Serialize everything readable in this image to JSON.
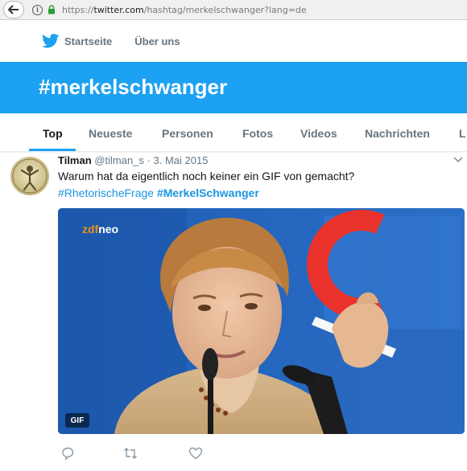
{
  "browser": {
    "url_prefix": "https://",
    "url_host": "twitter.com",
    "url_path": "/hashtag/merkelschwanger?lang=de"
  },
  "nav": {
    "home_label": "Startseite",
    "about_label": "Über uns"
  },
  "banner": {
    "hashtag_title": "#merkelschwanger"
  },
  "tabs": [
    "Top",
    "Neueste",
    "Personen",
    "Fotos",
    "Videos",
    "Nachrichten",
    "L"
  ],
  "tweet": {
    "fullname": "Tilman",
    "username": "@tilman_s",
    "separator": "·",
    "date": "3. Mai 2015",
    "text": "Warum hat da eigentlich noch keiner ein GIF von gemacht?",
    "hashtag_1": "#RhetorischeFrage",
    "hashtag_2": "#MerkelSchwanger",
    "media": {
      "logo_zdf": "zdf",
      "logo_neo": "neo",
      "badge": "GIF"
    }
  },
  "colors": {
    "brand": "#1da1f2",
    "link": "#1b95e0"
  },
  "icons": [
    "back-icon",
    "info-icon",
    "lock-icon",
    "twitter-bird-icon",
    "chevron-down-icon",
    "reply-icon",
    "retweet-icon",
    "like-icon"
  ]
}
